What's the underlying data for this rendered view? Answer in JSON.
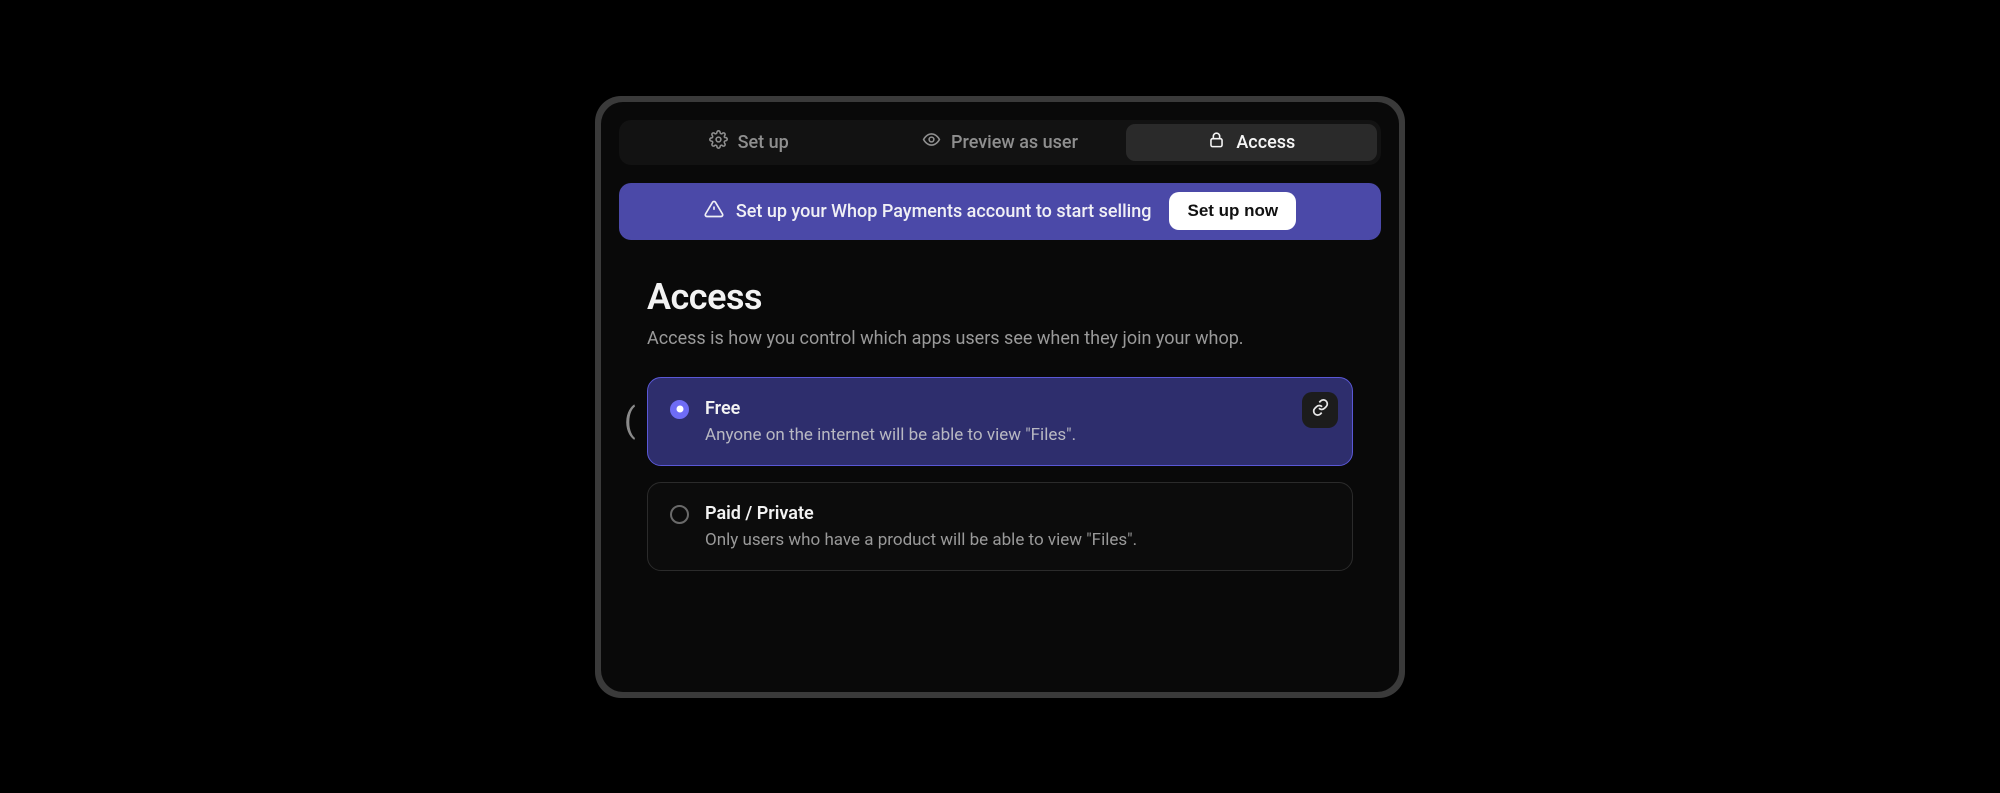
{
  "tabs": {
    "setup": {
      "label": "Set up"
    },
    "preview": {
      "label": "Preview as user"
    },
    "access": {
      "label": "Access"
    }
  },
  "banner": {
    "message": "Set up your Whop Payments account to start selling",
    "cta": "Set up now"
  },
  "heading": {
    "title": "Access",
    "subtitle": "Access is how you control which apps users see when they join your whop."
  },
  "options": {
    "free": {
      "title": "Free",
      "desc": "Anyone on the internet will be able to view \"Files\"."
    },
    "paid": {
      "title": "Paid / Private",
      "desc": "Only users who have a product will be able to view \"Files\"."
    }
  },
  "edge_glyph": "("
}
